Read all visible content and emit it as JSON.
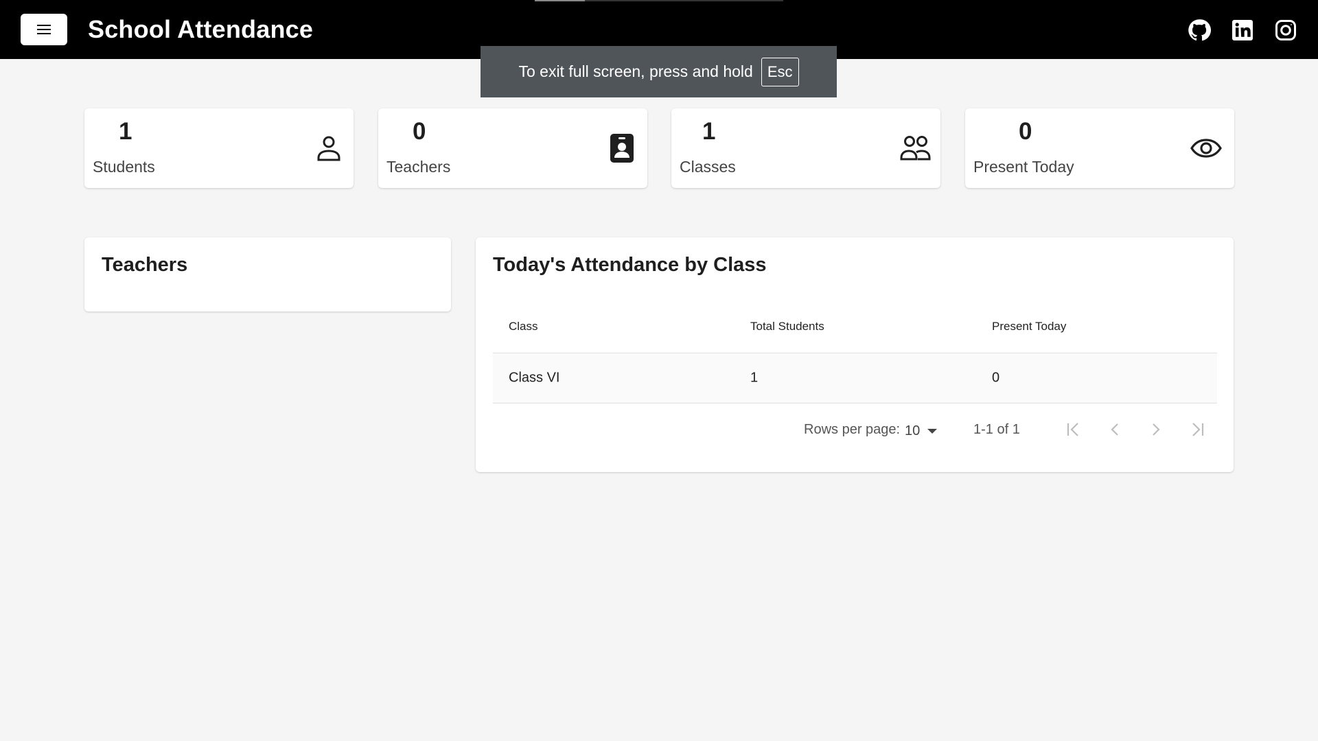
{
  "header": {
    "title": "School Attendance",
    "menu_icon": "hamburger-menu-icon",
    "social_icons": [
      "github-icon",
      "linkedin-icon",
      "instagram-icon"
    ]
  },
  "fullscreen_notice": {
    "text": "To exit full screen, press and hold",
    "key": "Esc"
  },
  "stats": [
    {
      "value": "1",
      "label": "Students",
      "icon": "person-icon"
    },
    {
      "value": "0",
      "label": "Teachers",
      "icon": "id-badge-icon"
    },
    {
      "value": "1",
      "label": "Classes",
      "icon": "people-icon"
    },
    {
      "value": "0",
      "label": "Present Today",
      "icon": "eye-icon"
    }
  ],
  "teachers_panel": {
    "title": "Teachers"
  },
  "attendance_panel": {
    "title": "Today's Attendance by Class",
    "columns": [
      "Class",
      "Total Students",
      "Present Today"
    ],
    "rows": [
      [
        "Class VI",
        "1",
        "0"
      ]
    ],
    "pagination": {
      "rows_per_page_label": "Rows per page:",
      "rows_per_page_value": "10",
      "page_info": "1-1 of 1"
    }
  },
  "colors": {
    "header_bg": "#000000",
    "page_bg": "#f5f5f5",
    "card_bg": "#ffffff",
    "toast_bg": "#50555a"
  }
}
